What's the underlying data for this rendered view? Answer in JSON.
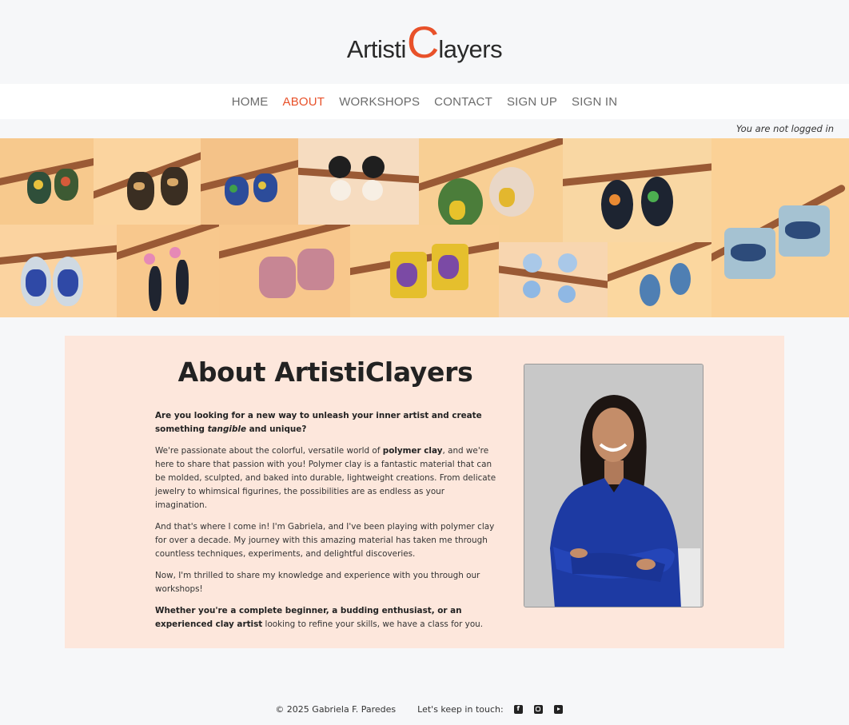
{
  "brand": {
    "logo_part1": "Artisti",
    "logo_big_c": "C",
    "logo_part2": "layers",
    "accent_color": "#e8512a"
  },
  "nav": {
    "items": [
      {
        "label": "HOME",
        "active": false
      },
      {
        "label": "ABOUT",
        "active": true
      },
      {
        "label": "WORKSHOPS",
        "active": false
      },
      {
        "label": "CONTACT",
        "active": false
      },
      {
        "label": "SIGN UP",
        "active": false
      },
      {
        "label": "SIGN IN",
        "active": false
      }
    ]
  },
  "status": {
    "login_text": "You are not logged in"
  },
  "banner": {
    "alt": "Polymer clay earrings on a wooden branch"
  },
  "about": {
    "title": "About ArtistiClayers",
    "intro_bold_1": "Are you looking for a new way to unleash your inner artist and create something ",
    "intro_italic": "tangible",
    "intro_bold_2": " and unique?",
    "p2_part1": "We're passionate about the colorful, versatile world of ",
    "p2_bold": "polymer clay",
    "p2_part2": ", and we're here to share that passion with you! Polymer clay is a fantastic material that can be molded, sculpted, and baked into durable, lightweight creations. From delicate jewelry to whimsical figurines, the possibilities are as endless as your imagination.",
    "p3": "And that's where I come in! I'm Gabriela, and I've been playing with polymer clay for over a decade. My journey with this amazing material has taken me through countless techniques, experiments, and delightful discoveries.",
    "p4": "Now, I'm thrilled to share my knowledge and experience with you through our workshops!",
    "p5_bold": "Whether you're a complete beginner, a budding enthusiast, or an experienced clay artist",
    "p5_rest": " looking to refine your skills, we have a class for you."
  },
  "footer": {
    "copyright": "© 2025 Gabriela F. Paredes",
    "keep_in_touch": "Let's keep in touch:",
    "social_icons": [
      "facebook-icon",
      "instagram-icon",
      "youtube-icon"
    ]
  }
}
